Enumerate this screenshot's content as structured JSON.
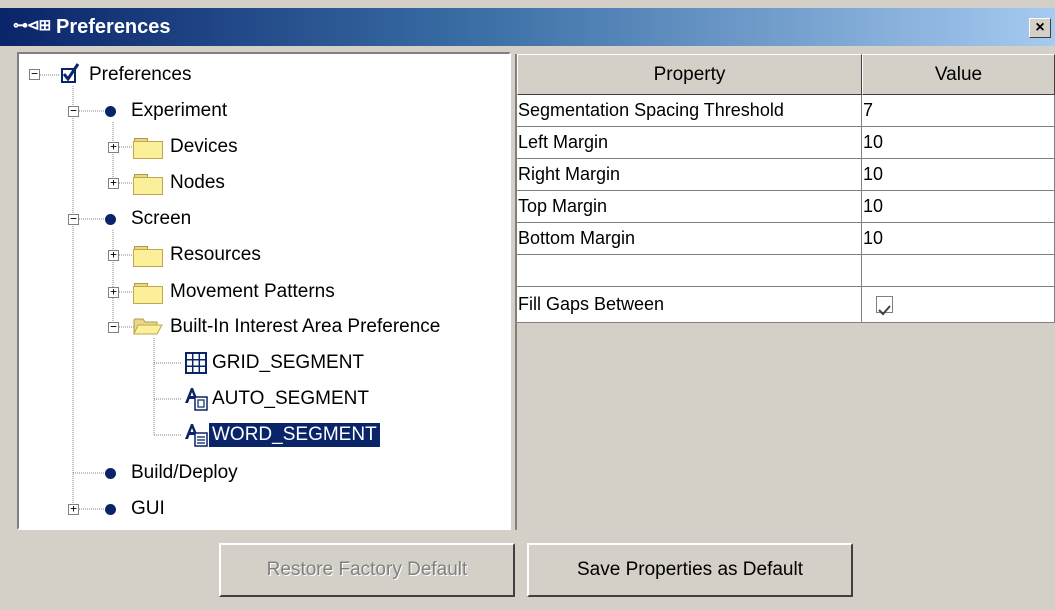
{
  "window": {
    "title": "Preferences",
    "title_icon": "⊶⊲⊞",
    "close_label": "×"
  },
  "tree": {
    "root": "Preferences",
    "experiment": "Experiment",
    "devices": "Devices",
    "nodes": "Nodes",
    "screen": "Screen",
    "resources": "Resources",
    "movement_patterns": "Movement Patterns",
    "builtin_ia": "Built-In Interest Area Preference",
    "grid_segment": "GRID_SEGMENT",
    "auto_segment": "AUTO_SEGMENT",
    "word_segment": "WORD_SEGMENT",
    "build_deploy": "Build/Deploy",
    "gui": "GUI",
    "selected": "WORD_SEGMENT"
  },
  "table": {
    "headers": {
      "property": "Property",
      "value": "Value"
    },
    "rows": [
      {
        "property": "Segmentation Spacing Threshold",
        "value": "7"
      },
      {
        "property": "Left Margin",
        "value": "10"
      },
      {
        "property": "Right Margin",
        "value": "10"
      },
      {
        "property": "Top Margin",
        "value": "10"
      },
      {
        "property": "Bottom Margin",
        "value": "10"
      },
      {
        "property": "",
        "value": ""
      },
      {
        "property": "Fill Gaps Between",
        "value": ""
      }
    ],
    "fill_gaps_checked": true
  },
  "buttons": {
    "restore": "Restore Factory Default",
    "save": "Save Properties as Default"
  },
  "colors": {
    "selection": "#0a246a",
    "titlebar_start": "#0a246a",
    "titlebar_end": "#a6caf0",
    "face": "#d4d0c8"
  }
}
